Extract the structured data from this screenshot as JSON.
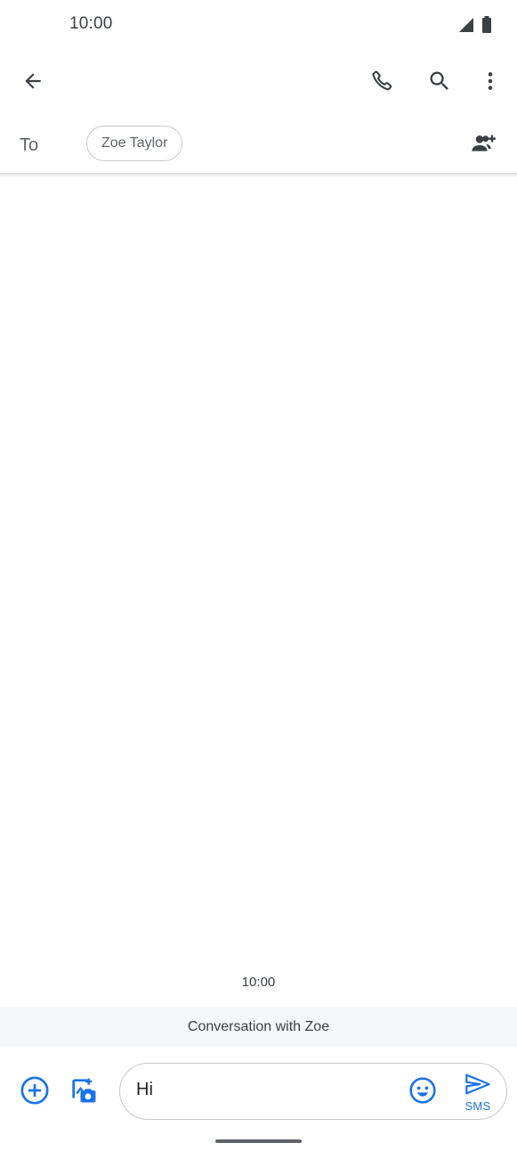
{
  "status_bar": {
    "time": "10:00",
    "icons": [
      "signal-icon",
      "battery-icon"
    ]
  },
  "toolbar": {
    "back_icon": "arrow-back-icon",
    "actions": [
      "phone-icon",
      "search-icon",
      "more-vert-icon"
    ]
  },
  "recipients": {
    "to_label": "To",
    "chips": [
      "Zoe Taylor"
    ],
    "add_icon": "add-person-icon"
  },
  "conversation": {
    "timestamp": "10:00",
    "banner": "Conversation with Zoe"
  },
  "compose": {
    "attach_icon": "add-circle-icon",
    "gallery_icon": "gallery-camera-icon",
    "input_value": "Hi",
    "emoji_icon": "emoji-icon",
    "send_icon": "send-icon",
    "send_label": "SMS"
  },
  "colors": {
    "accent": "#1a73e8",
    "icon_dark": "#3c4043",
    "banner_bg": "#f5f6f7"
  }
}
